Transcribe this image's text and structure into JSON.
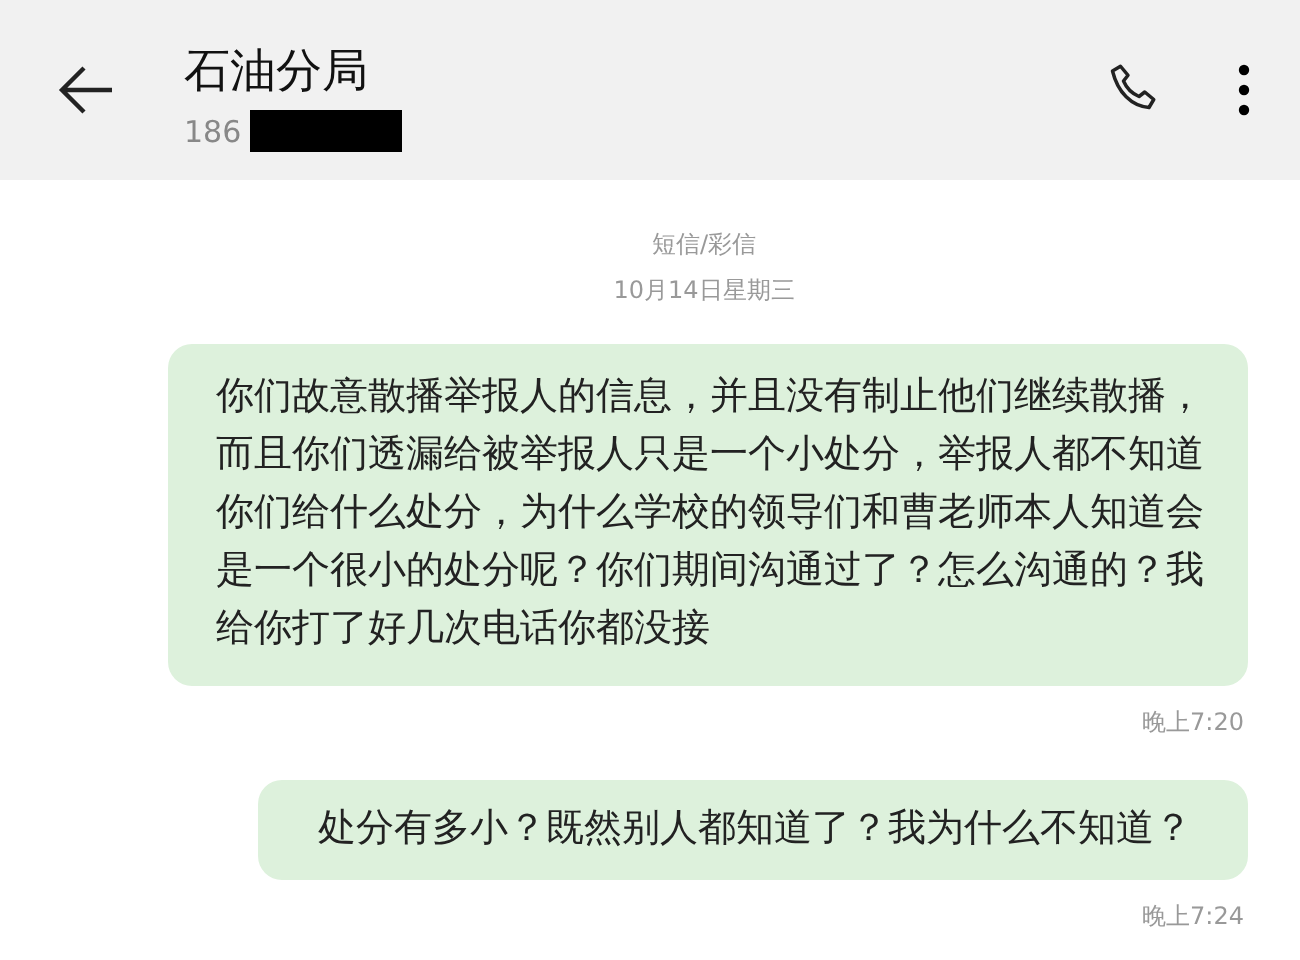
{
  "header": {
    "contact_name": "石油分局",
    "number_prefix": "186"
  },
  "conversation": {
    "channel_label": "短信/彩信",
    "date": "10月14日星期三"
  },
  "messages": [
    {
      "text": "你们故意散播举报人的信息，并且没有制止他们继续散播，而且你们透漏给被举报人只是一个小处分，举报人都不知道你们给什么处分，为什么学校的领导们和曹老师本人知道会是一个很小的处分呢？你们期间沟通过了？怎么沟通的？我给你打了好几次电话你都没接",
      "time": "晚上7:20"
    },
    {
      "text": "处分有多小？既然别人都知道了？我为什么不知道？",
      "time": "晚上7:24"
    }
  ]
}
